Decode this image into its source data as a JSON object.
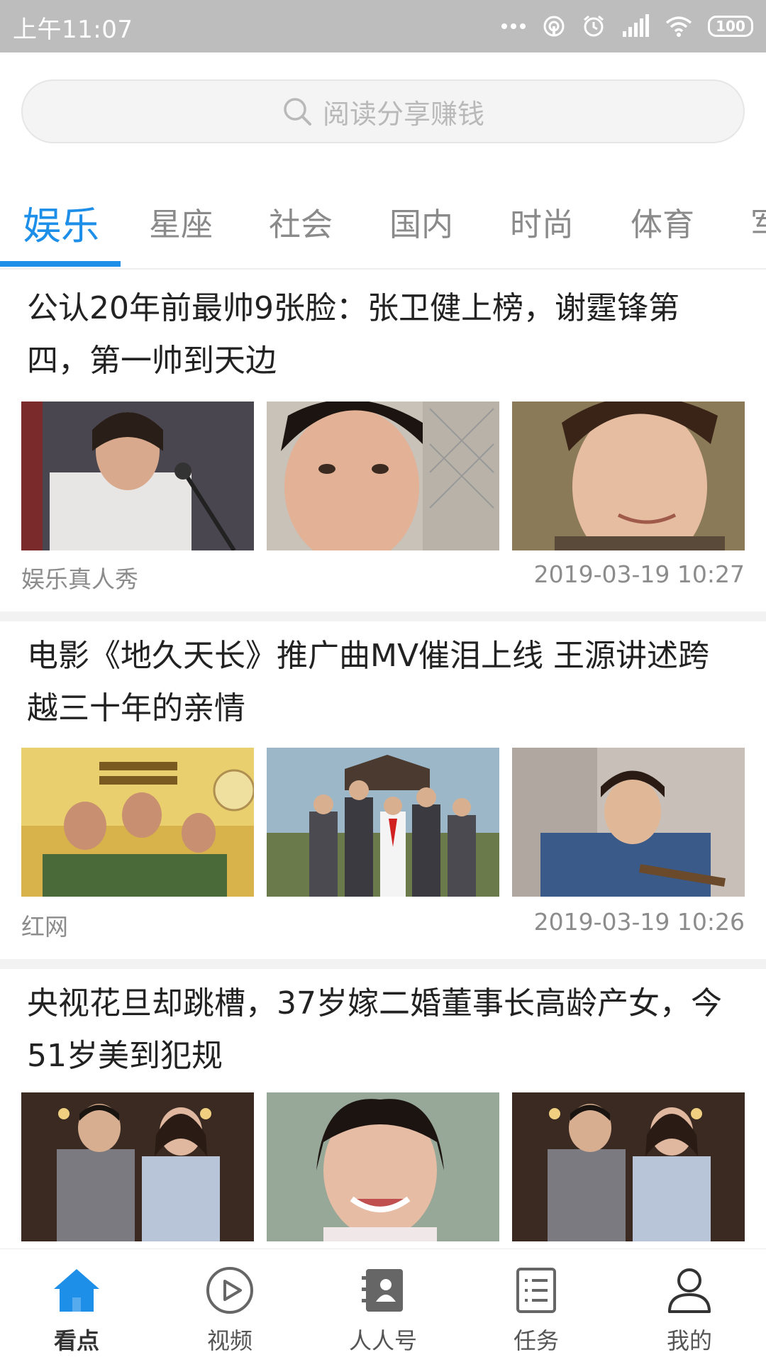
{
  "status_bar": {
    "time": "上午11:07",
    "battery": "100",
    "icons": [
      "more-dots-icon",
      "hotspot-icon",
      "alarm-icon",
      "hd-signal-icon",
      "wifi-icon",
      "battery-icon"
    ]
  },
  "search": {
    "placeholder": "阅读分享赚钱",
    "icon": "search-icon"
  },
  "tabs": [
    {
      "label": "娱乐",
      "active": true
    },
    {
      "label": "星座",
      "active": false
    },
    {
      "label": "社会",
      "active": false
    },
    {
      "label": "国内",
      "active": false
    },
    {
      "label": "时尚",
      "active": false
    },
    {
      "label": "体育",
      "active": false
    },
    {
      "label": "军",
      "active": false
    }
  ],
  "accent_color": "#1e8fe8",
  "articles": [
    {
      "title": "公认20年前最帅9张脸：张卫健上榜，谢霆锋第四，第一帅到天边",
      "source": "娱乐真人秀",
      "time": "2019-03-19 10:27",
      "images": [
        "photo-singer-microphone",
        "photo-young-man-portrait",
        "photo-smiling-man-portrait"
      ]
    },
    {
      "title": "电影《地久天长》推广曲MV催泪上线 王源讲述跨越三十年的亲情",
      "source": "红网",
      "time": "2019-03-19 10:26",
      "images": [
        "photo-movie-poster-family-table",
        "photo-family-group-outdoors",
        "photo-young-man-guitar"
      ]
    },
    {
      "title": "央视花旦却跳槽，37岁嫁二婚董事长高龄产女，今51岁美到犯规",
      "source": "",
      "time": "",
      "images": [
        "photo-couple-formal",
        "photo-smiling-woman",
        "photo-couple-formal"
      ]
    }
  ],
  "bottom_nav": [
    {
      "label": "看点",
      "icon": "home-icon",
      "active": true
    },
    {
      "label": "视频",
      "icon": "play-circle-icon",
      "active": false
    },
    {
      "label": "人人号",
      "icon": "contacts-book-icon",
      "active": false
    },
    {
      "label": "任务",
      "icon": "task-list-icon",
      "active": false
    },
    {
      "label": "我的",
      "icon": "user-profile-icon",
      "active": false
    }
  ]
}
